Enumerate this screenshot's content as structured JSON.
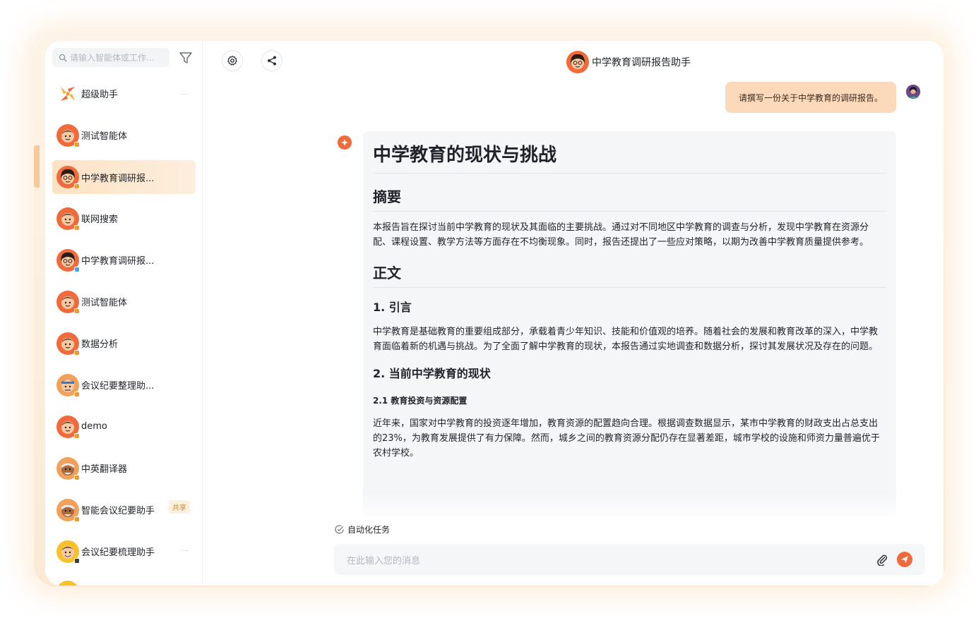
{
  "sidebar": {
    "search_placeholder": "请输入智能体或工作...",
    "items": [
      {
        "label": "超级助手",
        "avatar": "super-assistant-logo",
        "shared": ""
      },
      {
        "label": "测试智能体",
        "avatar": "cartoon-man-avatar",
        "shared": ""
      },
      {
        "label": "中学教育调研报...",
        "avatar": "cartoon-woman-glasses-avatar",
        "shared": "",
        "active": true
      },
      {
        "label": "联网搜索",
        "avatar": "cartoon-man-avatar",
        "shared": ""
      },
      {
        "label": "中学教育调研报...",
        "avatar": "cartoon-woman-glasses-avatar",
        "shared": ""
      },
      {
        "label": "测试智能体",
        "avatar": "cartoon-man-avatar",
        "shared": ""
      },
      {
        "label": "数据分析",
        "avatar": "cartoon-man-avatar",
        "shared": ""
      },
      {
        "label": "会议纪要整理助...",
        "avatar": "cartoon-blue-man-avatar",
        "shared": ""
      },
      {
        "label": "demo",
        "avatar": "cartoon-man-avatar",
        "shared": ""
      },
      {
        "label": "中英翻译器",
        "avatar": "cartoon-old-man-avatar",
        "shared": ""
      },
      {
        "label": "智能会议纪要助手",
        "avatar": "cartoon-old-man-avatar",
        "shared": "共享"
      },
      {
        "label": "会议纪要梳理助手",
        "avatar": "cartoon-yellow-man-avatar",
        "shared": ""
      }
    ]
  },
  "header": {
    "title": "中学教育调研报告助手"
  },
  "chat": {
    "user_message": "请撰写一份关于中学教育的调研报告。",
    "answer": {
      "title": "中学教育的现状与挑战",
      "section_abstract": "摘要",
      "abstract_text": "本报告旨在探讨当前中学教育的现状及其面临的主要挑战。通过对不同地区中学教育的调查与分析，发现中学教育在资源分配、课程设置、教学方法等方面存在不均衡现象。同时，报告还提出了一些应对策略，以期为改善中学教育质量提供参考。",
      "section_body": "正文",
      "intro_heading": "1. 引言",
      "intro_text": "中学教育是基础教育的重要组成部分，承载着青少年知识、技能和价值观的培养。随着社会的发展和教育改革的深入，中学教育面临着新的机遇与挑战。为了全面了解中学教育的现状，本报告通过实地调查和数据分析，探讨其发展状况及存在的问题。",
      "status_heading": "2. 当前中学教育的现状",
      "sub_heading": "2.1 教育投资与资源配置",
      "sub_text": "近年来，国家对中学教育的投资逐年增加，教育资源的配置趋向合理。根据调查数据显示，某市中学教育的财政支出占总支出的23%，为教育发展提供了有力保障。然而，城乡之间的教育资源分配仍存在显著差距，城市学校的设施和师资力量普遍优于农村学校。"
    }
  },
  "footer": {
    "auto_task_label": "自动化任务",
    "input_placeholder": "在此输入您的消息"
  },
  "colors": {
    "accent": "#f06a3b",
    "user_bubble": "#fcd9bb",
    "active_item": "#fde2c5"
  }
}
